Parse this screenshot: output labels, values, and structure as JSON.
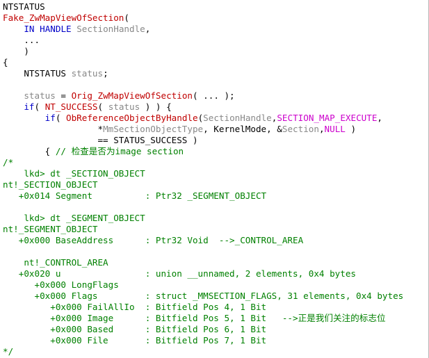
{
  "colors": {
    "keyword": "#0000c8",
    "function": "#c00000",
    "comment": "#008000",
    "type": "#888888",
    "plain": "#000000",
    "macro": "#cc00cc",
    "background": "#ffffff"
  },
  "lines": [
    [
      {
        "t": "NTSTATUS",
        "c": "pl"
      }
    ],
    [
      {
        "t": "Fake_ZwMapViewOfSection",
        "c": "fn"
      },
      {
        "t": "(",
        "c": "pl"
      }
    ],
    [
      {
        "t": "    ",
        "c": "pl"
      },
      {
        "t": "IN",
        "c": "kw"
      },
      {
        "t": " ",
        "c": "pl"
      },
      {
        "t": "HANDLE",
        "c": "kw"
      },
      {
        "t": " SectionHandle",
        "c": "ty"
      },
      {
        "t": ",",
        "c": "pl"
      }
    ],
    [
      {
        "t": "    ...",
        "c": "pl"
      }
    ],
    [
      {
        "t": "    )",
        "c": "pl"
      }
    ],
    [
      {
        "t": "{",
        "c": "pl"
      }
    ],
    [
      {
        "t": "    NTSTATUS ",
        "c": "pl"
      },
      {
        "t": "status",
        "c": "ty"
      },
      {
        "t": ";",
        "c": "pl"
      }
    ],
    [
      {
        "t": "",
        "c": "pl"
      }
    ],
    [
      {
        "t": "    ",
        "c": "pl"
      },
      {
        "t": "status",
        "c": "ty"
      },
      {
        "t": " = ",
        "c": "pl"
      },
      {
        "t": "Orig_ZwMapViewOfSection",
        "c": "fn"
      },
      {
        "t": "( ... );",
        "c": "pl"
      }
    ],
    [
      {
        "t": "    ",
        "c": "pl"
      },
      {
        "t": "if",
        "c": "kw"
      },
      {
        "t": "( ",
        "c": "pl"
      },
      {
        "t": "NT_SUCCESS",
        "c": "fn"
      },
      {
        "t": "( ",
        "c": "pl"
      },
      {
        "t": "status",
        "c": "ty"
      },
      {
        "t": " ) ) {",
        "c": "pl"
      }
    ],
    [
      {
        "t": "        ",
        "c": "pl"
      },
      {
        "t": "if",
        "c": "kw"
      },
      {
        "t": "( ",
        "c": "pl"
      },
      {
        "t": "ObReferenceObjectByHandle",
        "c": "fn"
      },
      {
        "t": "(",
        "c": "pl"
      },
      {
        "t": "SectionHandle",
        "c": "ty"
      },
      {
        "t": ",",
        "c": "pl"
      },
      {
        "t": "SECTION_MAP_EXECUTE",
        "c": "mg"
      },
      {
        "t": ",",
        "c": "pl"
      }
    ],
    [
      {
        "t": "                  *",
        "c": "pl"
      },
      {
        "t": "MmSectionObjectType",
        "c": "ty"
      },
      {
        "t": ", KernelMode, &",
        "c": "pl"
      },
      {
        "t": "Section",
        "c": "ty"
      },
      {
        "t": ",",
        "c": "pl"
      },
      {
        "t": "NULL",
        "c": "mg"
      },
      {
        "t": " )",
        "c": "pl"
      }
    ],
    [
      {
        "t": "                  == STATUS_SUCCESS )",
        "c": "pl"
      }
    ],
    [
      {
        "t": "        { ",
        "c": "pl"
      },
      {
        "t": "// 检查是否为image section",
        "c": "cm"
      }
    ],
    [
      {
        "t": "/*",
        "c": "cm"
      }
    ],
    [
      {
        "t": "    lkd> dt _SECTION_OBJECT",
        "c": "cm"
      }
    ],
    [
      {
        "t": "nt!_SECTION_OBJECT",
        "c": "cm"
      }
    ],
    [
      {
        "t": "   +0x014 Segment          : Ptr32 _SEGMENT_OBJECT",
        "c": "cm"
      }
    ],
    [
      {
        "t": "",
        "c": "cm"
      }
    ],
    [
      {
        "t": "    lkd> dt _SEGMENT_OBJECT",
        "c": "cm"
      }
    ],
    [
      {
        "t": "nt!_SEGMENT_OBJECT",
        "c": "cm"
      }
    ],
    [
      {
        "t": "   +0x000 BaseAddress      : Ptr32 Void  -->_CONTROL_AREA",
        "c": "cm"
      }
    ],
    [
      {
        "t": "",
        "c": "cm"
      }
    ],
    [
      {
        "t": "    nt!_CONTROL_AREA",
        "c": "cm"
      }
    ],
    [
      {
        "t": "   +0x020 u                : union __unnamed, 2 elements, 0x4 bytes",
        "c": "cm"
      }
    ],
    [
      {
        "t": "      +0x000 LongFlags",
        "c": "cm"
      }
    ],
    [
      {
        "t": "      +0x000 Flags         : struct _MMSECTION_FLAGS, 31 elements, 0x4 bytes",
        "c": "cm"
      }
    ],
    [
      {
        "t": "         +0x000 FailAllIo  : Bitfield Pos 4, 1 Bit",
        "c": "cm"
      }
    ],
    [
      {
        "t": "         +0x000 Image      : Bitfield Pos 5, 1 Bit   -->正是我们关注的标志位",
        "c": "cm"
      }
    ],
    [
      {
        "t": "         +0x000 Based      : Bitfield Pos 6, 1 Bit",
        "c": "cm"
      }
    ],
    [
      {
        "t": "         +0x000 File       : Bitfield Pos 7, 1 Bit",
        "c": "cm"
      }
    ],
    [
      {
        "t": "*/",
        "c": "cm"
      }
    ]
  ]
}
